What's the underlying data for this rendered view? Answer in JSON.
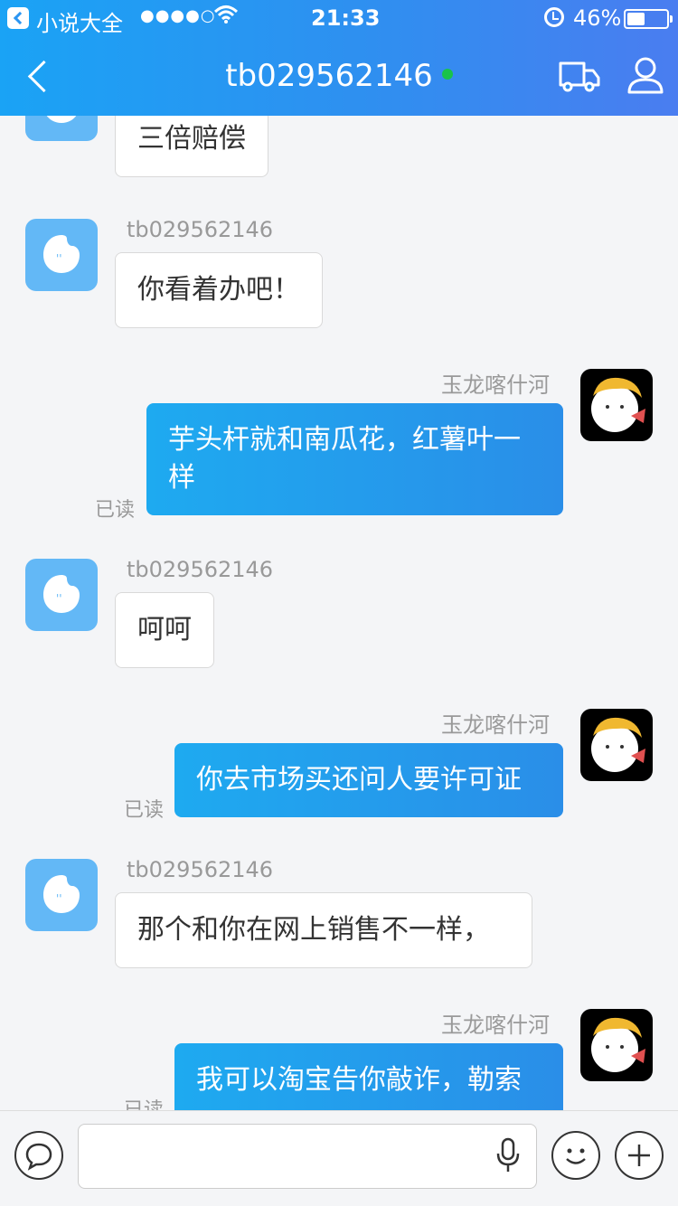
{
  "status_bar": {
    "app_name": "小说大全",
    "signal": "●●●●○",
    "time": "21:33",
    "battery_text": "46%",
    "battery_level": 0.46
  },
  "nav": {
    "title": "tb029562146",
    "online_color": "#19c34a",
    "icons": [
      "back-icon",
      "truck-icon",
      "user-icon"
    ]
  },
  "messages": [
    {
      "side": "in",
      "sender": "",
      "text": "三倍赔偿"
    },
    {
      "side": "in",
      "sender": "tb029562146",
      "text": "你看着办吧！"
    },
    {
      "side": "out",
      "sender": "玉龙喀什河",
      "lines": [
        "芋头杆就和南瓜花，红薯叶一",
        "样"
      ],
      "status": "已读"
    },
    {
      "side": "in",
      "sender": "tb029562146",
      "text": "呵呵"
    },
    {
      "side": "out",
      "sender": "玉龙喀什河",
      "text": "你去市场买还问人要许可证",
      "status": "已读"
    },
    {
      "side": "in",
      "sender": "tb029562146",
      "text": "那个和你在网上销售不一样，"
    },
    {
      "side": "out",
      "sender": "玉龙喀什河",
      "text": "我可以淘宝告你敲诈，勒索",
      "status": "已读"
    }
  ],
  "input_bar": {
    "placeholder": "",
    "icons": [
      "chat-bubble-icon",
      "microphone-icon",
      "emoji-icon",
      "plus-icon"
    ]
  },
  "colors": {
    "header_start": "#1aa3f5",
    "header_end": "#4a7df0",
    "bubble_out": "#1eaaf0",
    "avatar_blue": "#63b8f6"
  }
}
